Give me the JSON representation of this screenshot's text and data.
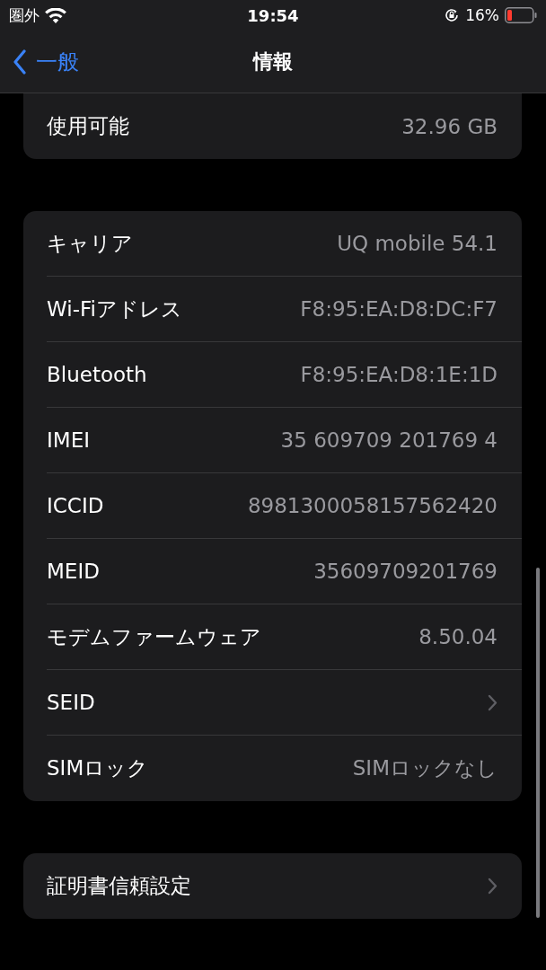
{
  "status_bar": {
    "carrier": "圏外",
    "time": "19:54",
    "battery_percent": "16%"
  },
  "nav": {
    "back": "一般",
    "title": "情報"
  },
  "groups": [
    {
      "cut_top": true,
      "rows": [
        {
          "kind": "value",
          "label": "使用可能",
          "value": "32.96 GB"
        }
      ]
    },
    {
      "cut_top": false,
      "rows": [
        {
          "kind": "value",
          "label": "キャリア",
          "value": "UQ mobile 54.1"
        },
        {
          "kind": "value",
          "label": "Wi-Fiアドレス",
          "value": "F8:95:EA:D8:DC:F7"
        },
        {
          "kind": "value",
          "label": "Bluetooth",
          "value": "F8:95:EA:D8:1E:1D"
        },
        {
          "kind": "value",
          "label": "IMEI",
          "value": "35 609709 201769 4"
        },
        {
          "kind": "value",
          "label": "ICCID",
          "value": "8981300058157562420"
        },
        {
          "kind": "value",
          "label": "MEID",
          "value": "35609709201769"
        },
        {
          "kind": "value",
          "label": "モデムファームウェア",
          "value": "8.50.04"
        },
        {
          "kind": "chevron",
          "label": "SEID"
        },
        {
          "kind": "value",
          "label": "SIMロック",
          "value": "SIMロックなし"
        }
      ]
    },
    {
      "cut_top": false,
      "rows": [
        {
          "kind": "chevron",
          "label": "証明書信頼設定"
        }
      ]
    }
  ]
}
